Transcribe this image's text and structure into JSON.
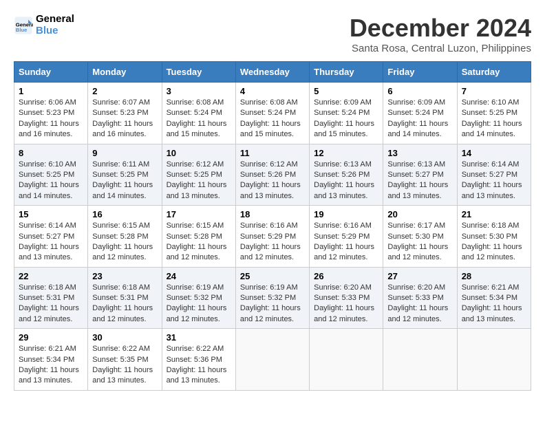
{
  "header": {
    "logo_line1": "General",
    "logo_line2": "Blue",
    "month_title": "December 2024",
    "subtitle": "Santa Rosa, Central Luzon, Philippines"
  },
  "days_of_week": [
    "Sunday",
    "Monday",
    "Tuesday",
    "Wednesday",
    "Thursday",
    "Friday",
    "Saturday"
  ],
  "weeks": [
    [
      {
        "day": 1,
        "sunrise": "6:06 AM",
        "sunset": "5:23 PM",
        "daylight": "11 hours and 16 minutes."
      },
      {
        "day": 2,
        "sunrise": "6:07 AM",
        "sunset": "5:23 PM",
        "daylight": "11 hours and 16 minutes."
      },
      {
        "day": 3,
        "sunrise": "6:08 AM",
        "sunset": "5:24 PM",
        "daylight": "11 hours and 15 minutes."
      },
      {
        "day": 4,
        "sunrise": "6:08 AM",
        "sunset": "5:24 PM",
        "daylight": "11 hours and 15 minutes."
      },
      {
        "day": 5,
        "sunrise": "6:09 AM",
        "sunset": "5:24 PM",
        "daylight": "11 hours and 15 minutes."
      },
      {
        "day": 6,
        "sunrise": "6:09 AM",
        "sunset": "5:24 PM",
        "daylight": "11 hours and 14 minutes."
      },
      {
        "day": 7,
        "sunrise": "6:10 AM",
        "sunset": "5:25 PM",
        "daylight": "11 hours and 14 minutes."
      }
    ],
    [
      {
        "day": 8,
        "sunrise": "6:10 AM",
        "sunset": "5:25 PM",
        "daylight": "11 hours and 14 minutes."
      },
      {
        "day": 9,
        "sunrise": "6:11 AM",
        "sunset": "5:25 PM",
        "daylight": "11 hours and 14 minutes."
      },
      {
        "day": 10,
        "sunrise": "6:12 AM",
        "sunset": "5:25 PM",
        "daylight": "11 hours and 13 minutes."
      },
      {
        "day": 11,
        "sunrise": "6:12 AM",
        "sunset": "5:26 PM",
        "daylight": "11 hours and 13 minutes."
      },
      {
        "day": 12,
        "sunrise": "6:13 AM",
        "sunset": "5:26 PM",
        "daylight": "11 hours and 13 minutes."
      },
      {
        "day": 13,
        "sunrise": "6:13 AM",
        "sunset": "5:27 PM",
        "daylight": "11 hours and 13 minutes."
      },
      {
        "day": 14,
        "sunrise": "6:14 AM",
        "sunset": "5:27 PM",
        "daylight": "11 hours and 13 minutes."
      }
    ],
    [
      {
        "day": 15,
        "sunrise": "6:14 AM",
        "sunset": "5:27 PM",
        "daylight": "11 hours and 13 minutes."
      },
      {
        "day": 16,
        "sunrise": "6:15 AM",
        "sunset": "5:28 PM",
        "daylight": "11 hours and 12 minutes."
      },
      {
        "day": 17,
        "sunrise": "6:15 AM",
        "sunset": "5:28 PM",
        "daylight": "11 hours and 12 minutes."
      },
      {
        "day": 18,
        "sunrise": "6:16 AM",
        "sunset": "5:29 PM",
        "daylight": "11 hours and 12 minutes."
      },
      {
        "day": 19,
        "sunrise": "6:16 AM",
        "sunset": "5:29 PM",
        "daylight": "11 hours and 12 minutes."
      },
      {
        "day": 20,
        "sunrise": "6:17 AM",
        "sunset": "5:30 PM",
        "daylight": "11 hours and 12 minutes."
      },
      {
        "day": 21,
        "sunrise": "6:18 AM",
        "sunset": "5:30 PM",
        "daylight": "11 hours and 12 minutes."
      }
    ],
    [
      {
        "day": 22,
        "sunrise": "6:18 AM",
        "sunset": "5:31 PM",
        "daylight": "11 hours and 12 minutes."
      },
      {
        "day": 23,
        "sunrise": "6:18 AM",
        "sunset": "5:31 PM",
        "daylight": "11 hours and 12 minutes."
      },
      {
        "day": 24,
        "sunrise": "6:19 AM",
        "sunset": "5:32 PM",
        "daylight": "11 hours and 12 minutes."
      },
      {
        "day": 25,
        "sunrise": "6:19 AM",
        "sunset": "5:32 PM",
        "daylight": "11 hours and 12 minutes."
      },
      {
        "day": 26,
        "sunrise": "6:20 AM",
        "sunset": "5:33 PM",
        "daylight": "11 hours and 12 minutes."
      },
      {
        "day": 27,
        "sunrise": "6:20 AM",
        "sunset": "5:33 PM",
        "daylight": "11 hours and 12 minutes."
      },
      {
        "day": 28,
        "sunrise": "6:21 AM",
        "sunset": "5:34 PM",
        "daylight": "11 hours and 13 minutes."
      }
    ],
    [
      {
        "day": 29,
        "sunrise": "6:21 AM",
        "sunset": "5:34 PM",
        "daylight": "11 hours and 13 minutes."
      },
      {
        "day": 30,
        "sunrise": "6:22 AM",
        "sunset": "5:35 PM",
        "daylight": "11 hours and 13 minutes."
      },
      {
        "day": 31,
        "sunrise": "6:22 AM",
        "sunset": "5:36 PM",
        "daylight": "11 hours and 13 minutes."
      },
      null,
      null,
      null,
      null
    ]
  ],
  "labels": {
    "sunrise": "Sunrise:",
    "sunset": "Sunset:",
    "daylight": "Daylight:"
  }
}
